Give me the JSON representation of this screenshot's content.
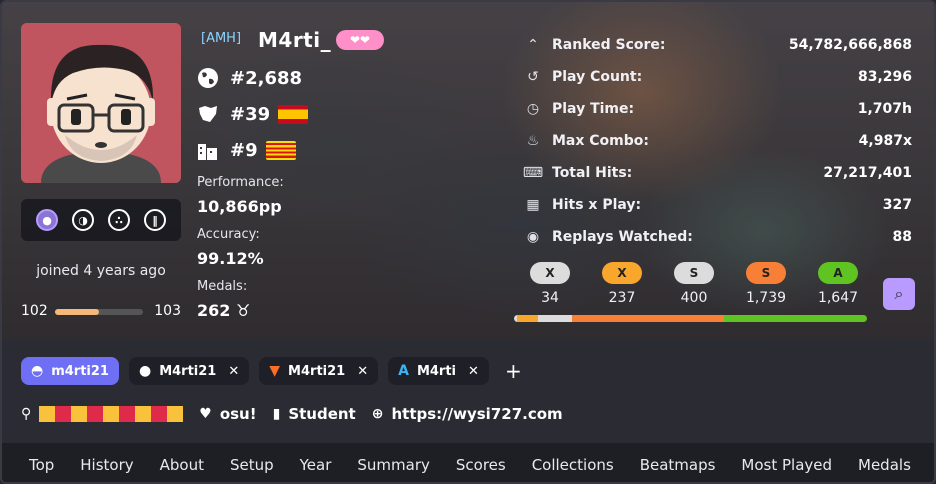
{
  "profile": {
    "tag": "[AMH]",
    "username": "M4rti_",
    "supporter": "❤❤",
    "global_rank": "#2,688",
    "region_rank": "#39",
    "country_rank": "#9",
    "joined": "joined 4 years ago"
  },
  "level": {
    "current": "102",
    "next": "103",
    "progress": 0.5
  },
  "labels": {
    "performance": "Performance:",
    "accuracy": "Accuracy:",
    "medals": "Medals:"
  },
  "values": {
    "performance": "10,866pp",
    "accuracy": "99.12%",
    "medals": "262"
  },
  "stats": [
    {
      "icon": "chevrons-up-icon",
      "glyph": "⌃",
      "label": "Ranked Score:",
      "value": "54,782,666,868"
    },
    {
      "icon": "replay-icon",
      "glyph": "↺",
      "label": "Play Count:",
      "value": "83,296"
    },
    {
      "icon": "clock-icon",
      "glyph": "◷",
      "label": "Play Time:",
      "value": "1,707h"
    },
    {
      "icon": "fire-icon",
      "glyph": "♨",
      "label": "Max Combo:",
      "value": "4,987x"
    },
    {
      "icon": "keyboard-icon",
      "glyph": "⌨",
      "label": "Total Hits:",
      "value": "27,217,401"
    },
    {
      "icon": "calculator-icon",
      "glyph": "▦",
      "label": "Hits x Play:",
      "value": "327"
    },
    {
      "icon": "eye-icon",
      "glyph": "◉",
      "label": "Replays Watched:",
      "value": "88"
    }
  ],
  "grades": [
    {
      "label": "X",
      "count": "34",
      "color": "#dcdcdc"
    },
    {
      "label": "X",
      "count": "237",
      "color": "#f9a62c"
    },
    {
      "label": "S",
      "count": "400",
      "color": "#dcdcdc"
    },
    {
      "label": "S",
      "count": "1,739",
      "color": "#f77f36"
    },
    {
      "label": "A",
      "count": "1,647",
      "color": "#5fc321"
    }
  ],
  "grade_bar": [
    {
      "share": 0.0084,
      "color": "#dcdcdc"
    },
    {
      "share": 0.0586,
      "color": "#f9a62c"
    },
    {
      "share": 0.0989,
      "color": "#dcdcdc"
    },
    {
      "share": 0.4298,
      "color": "#f77f36"
    },
    {
      "share": 0.4071,
      "color": "#5fc321"
    }
  ],
  "social": {
    "discord": "m4rti21",
    "github": "M4rti21",
    "gitlab": "M4rti21",
    "anilist": "M4rti",
    "add": "+"
  },
  "info": {
    "interest": "osu!",
    "occupation": "Student",
    "website": "https://wysi727.com"
  },
  "location_colors": [
    "#f9c23c",
    "#e02a4a",
    "#f9c23c",
    "#e02a4a",
    "#f9c23c",
    "#e02a4a",
    "#f9c23c",
    "#e02a4a",
    "#f9c23c"
  ],
  "nav": [
    "Top",
    "History",
    "About",
    "Setup",
    "Year",
    "Summary",
    "Scores",
    "Collections",
    "Beatmaps",
    "Most Played",
    "Medals"
  ],
  "colors": {
    "accent": "#b99bff",
    "discord": "#6f6ff5"
  }
}
